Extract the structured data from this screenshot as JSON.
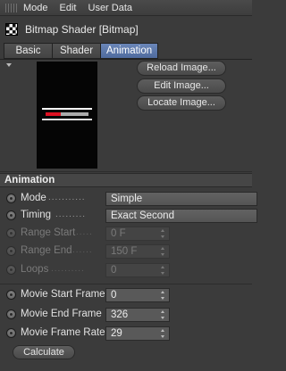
{
  "menu": [
    "Mode",
    "Edit",
    "User Data"
  ],
  "title": "Bitmap Shader [Bitmap]",
  "tabs": [
    {
      "label": "Basic",
      "active": false
    },
    {
      "label": "Shader",
      "active": false
    },
    {
      "label": "Animation",
      "active": true
    }
  ],
  "image_buttons": {
    "reload": "Reload Image...",
    "edit": "Edit Image...",
    "locate": "Locate Image..."
  },
  "section": "Animation",
  "params": {
    "mode": {
      "label": "Mode",
      "dots": "...........",
      "value": "Simple"
    },
    "timing": {
      "label": "Timing",
      "dots": ".........",
      "value": "Exact Second"
    },
    "range_start": {
      "label": "Range Start",
      "dots": ".....",
      "value": "0 F"
    },
    "range_end": {
      "label": "Range End",
      "dots": "......",
      "value": "150 F"
    },
    "loops": {
      "label": "Loops",
      "dots": "..........",
      "value": "0"
    },
    "movie_start": {
      "label": "Movie Start Frame",
      "value": "0"
    },
    "movie_end": {
      "label": "Movie End Frame",
      "value": "326"
    },
    "movie_rate": {
      "label": "Movie Frame Rate",
      "value": "29"
    }
  },
  "calculate": "Calculate",
  "colors": {
    "accent_tab": "#5a77aa",
    "panel_bg": "#3b3b3b"
  }
}
